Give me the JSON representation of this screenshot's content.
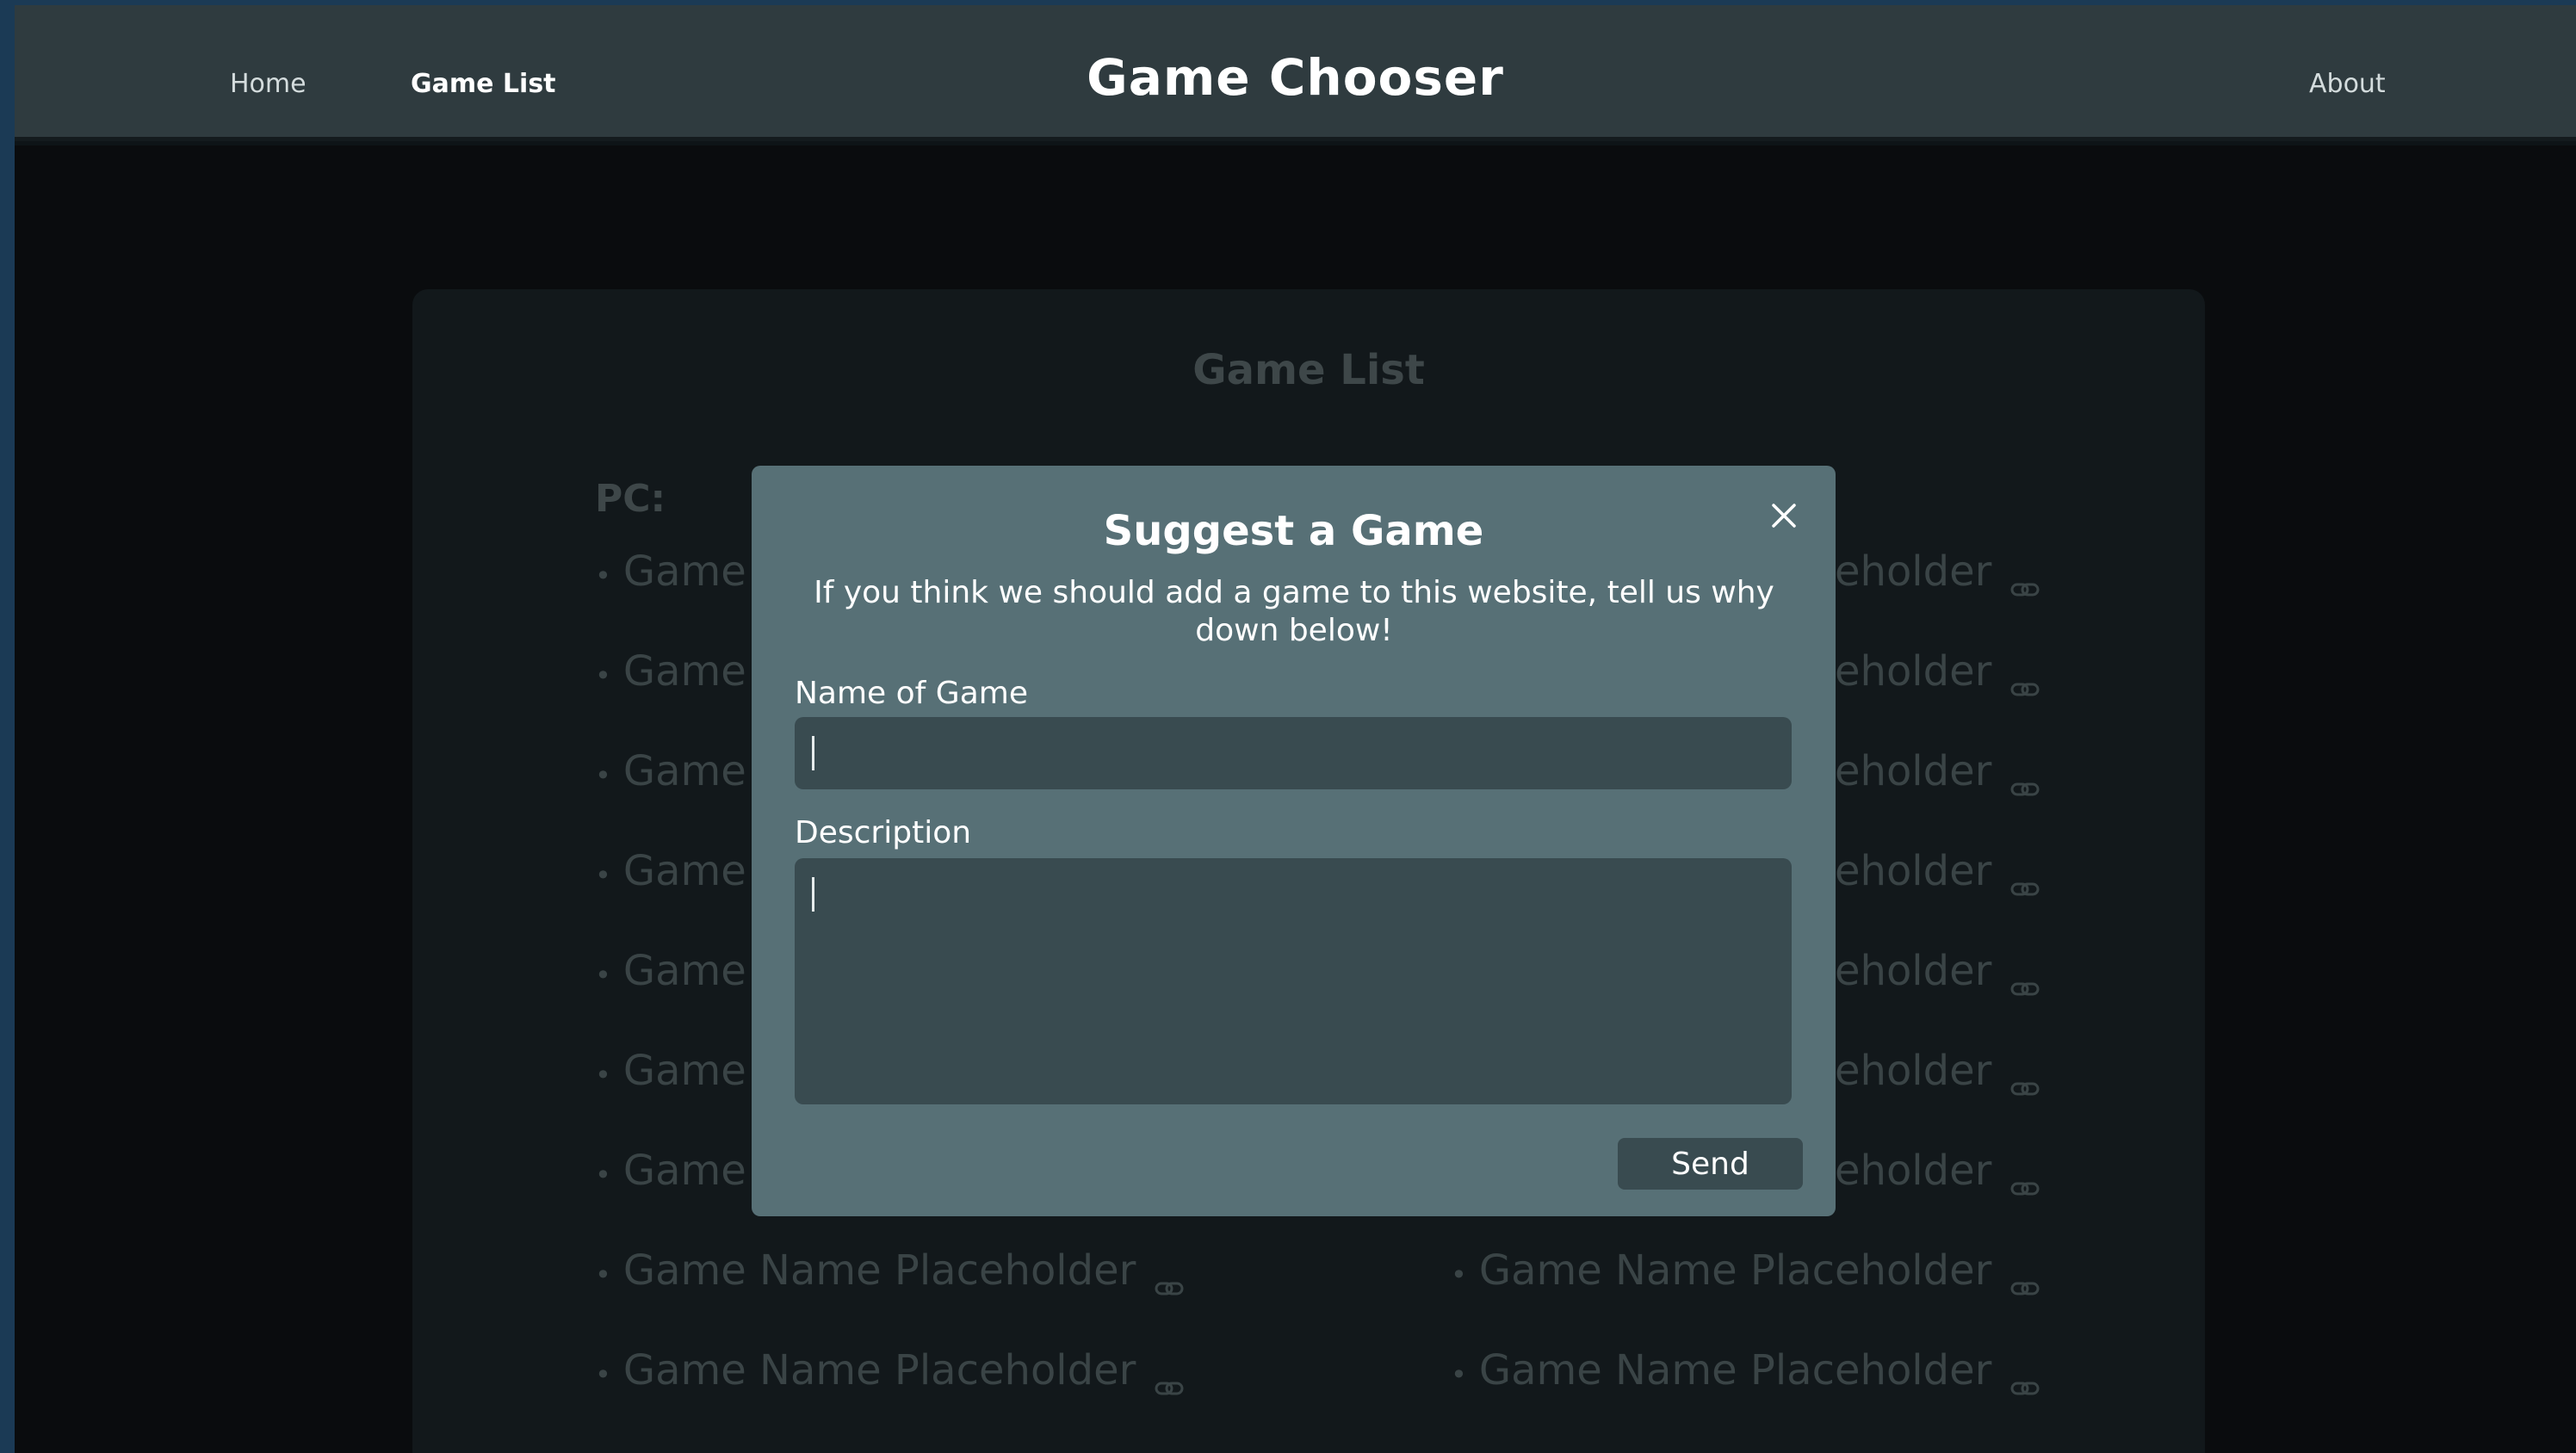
{
  "header": {
    "title": "Game Chooser",
    "nav": {
      "home": "Home",
      "game_list": "Game List",
      "about": "About"
    }
  },
  "page": {
    "card_title": "Game List",
    "category": "PC:",
    "left_column": [
      "Game Name Placeholder",
      "Game Name Placeholder",
      "Game Name Placeholder",
      "Game Name Placeholder",
      "Game Name Placeholder",
      "Game Name Placeholder",
      "Game Name Placeholder",
      "Game Name Placeholder",
      "Game Name Placeholder"
    ],
    "right_column": [
      "Game Name Placeholder",
      "Game Name Placeholder",
      "Game Name Placeholder",
      "Game Name Placeholder",
      "Game Name Placeholder",
      "Game Name Placeholder",
      "Game Name Placeholder",
      "Game Name Placeholder",
      "Game Name Placeholder"
    ],
    "bullet": "•"
  },
  "modal": {
    "title": "Suggest a Game",
    "description": "If you think we should add a game to this website, tell us why down below!",
    "name_label": "Name of Game",
    "name_value": "",
    "description_label": "Description",
    "description_value": "",
    "send_label": "Send"
  },
  "icons": {
    "close": "close-icon",
    "link": "link-icon"
  },
  "colors": {
    "header_bg": "#2f3b3f",
    "modal_bg": "#577076",
    "input_bg": "#394b50"
  }
}
